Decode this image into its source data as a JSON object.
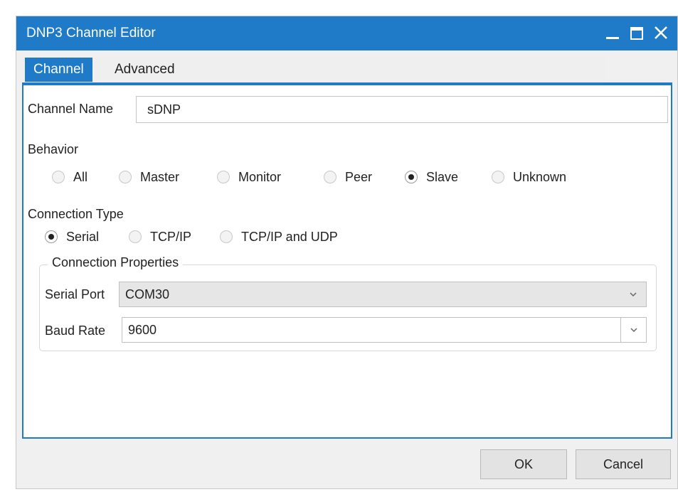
{
  "window": {
    "title": "DNP3 Channel Editor",
    "minimize_icon": "minimize-icon",
    "maximize_icon": "maximize-icon",
    "close_icon": "close-icon"
  },
  "tabs": [
    {
      "label": "Channel",
      "active": true
    },
    {
      "label": "Advanced",
      "active": false
    }
  ],
  "channel_name": {
    "label": "Channel Name",
    "value": "sDNP"
  },
  "behavior": {
    "label": "Behavior",
    "options": [
      "All",
      "Master",
      "Monitor",
      "Peer",
      "Slave",
      "Unknown"
    ],
    "selected": "Slave"
  },
  "connection_type": {
    "label": "Connection Type",
    "options": [
      "Serial",
      "TCP/IP",
      "TCP/IP and UDP"
    ],
    "selected": "Serial"
  },
  "connection_properties": {
    "legend": "Connection Properties",
    "serial_port": {
      "label": "Serial Port",
      "value": "COM30"
    },
    "baud_rate": {
      "label": "Baud Rate",
      "value": "9600"
    }
  },
  "buttons": {
    "ok": "OK",
    "cancel": "Cancel"
  },
  "colors": {
    "accent": "#1f7bc8",
    "background": "#f0f0f0",
    "panel": "#ffffff"
  }
}
